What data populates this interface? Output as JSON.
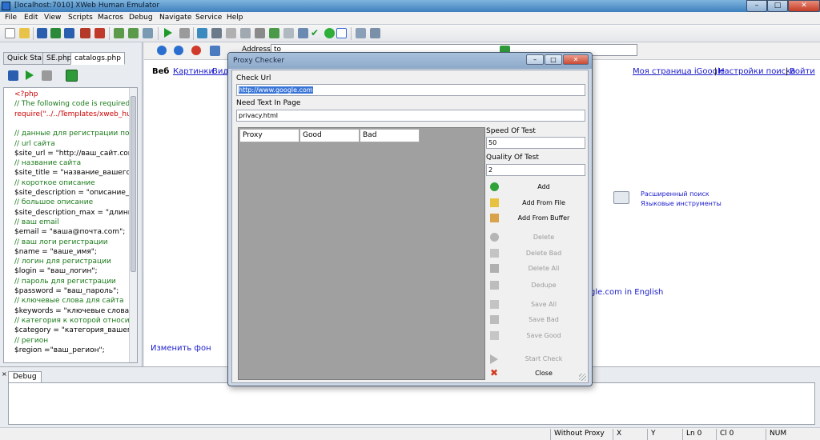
{
  "window": {
    "title": "[localhost:7010] XWeb Human Emulator",
    "minimize": "–",
    "maximize": "□",
    "close": "✕"
  },
  "menu": [
    "File",
    "Edit",
    "View",
    "Scripts",
    "Macros",
    "Debug",
    "Navigate",
    "Service",
    "Help"
  ],
  "left_tabs": [
    "Quick Start",
    "SE.php",
    "catalogs.php"
  ],
  "code_lines": [
    {
      "text": "<?php",
      "cls": "c-kw"
    },
    {
      "text": "// The following code is required",
      "cls": "c-cm"
    },
    {
      "text": "require(\"../../Templates/xweb_hu",
      "cls": "c-kw"
    },
    {
      "text": "",
      "cls": "c-var"
    },
    {
      "text": "// данные для регистрации по к",
      "cls": "c-cm"
    },
    {
      "text": "// url сайта",
      "cls": "c-cm"
    },
    {
      "text": "$site_url = \"http://ваш_сайт.con",
      "cls": "c-var"
    },
    {
      "text": "// название сайта",
      "cls": "c-cm"
    },
    {
      "text": "$site_title = \"название_вашего_",
      "cls": "c-var"
    },
    {
      "text": "// короткое описание",
      "cls": "c-cm"
    },
    {
      "text": "$site_description = \"описание_в",
      "cls": "c-var"
    },
    {
      "text": "// большое описание",
      "cls": "c-cm"
    },
    {
      "text": "$site_description_max = \"длинн",
      "cls": "c-var"
    },
    {
      "text": "// ваш email",
      "cls": "c-cm"
    },
    {
      "text": "$email = \"ваша@почта.com\";",
      "cls": "c-var"
    },
    {
      "text": "// ваш логи регистрации",
      "cls": "c-cm"
    },
    {
      "text": "$name = \"ваше_имя\";",
      "cls": "c-var"
    },
    {
      "text": "// логин для регистрации",
      "cls": "c-cm"
    },
    {
      "text": "$login = \"ваш_логин\";",
      "cls": "c-var"
    },
    {
      "text": "// пароль для регистрации",
      "cls": "c-cm"
    },
    {
      "text": "$password = \"ваш_пароль\";",
      "cls": "c-var"
    },
    {
      "text": "// ключевые слова для сайта",
      "cls": "c-cm"
    },
    {
      "text": "$keywords = \"ключевые слова\"",
      "cls": "c-var"
    },
    {
      "text": "// категория к которой относитс",
      "cls": "c-cm"
    },
    {
      "text": "$category = \"категория_вашего",
      "cls": "c-var"
    },
    {
      "text": "// регион",
      "cls": "c-cm"
    },
    {
      "text": "$region =\"ваш_регион\";",
      "cls": "c-var"
    }
  ],
  "browser": {
    "address_label": "Address",
    "address_value": "to",
    "google_left": [
      "Веб",
      "Картинки",
      "Вид"
    ],
    "google_right": [
      "Моя страница iGoogle",
      "|",
      "Настройки поиска",
      "|",
      "Войти"
    ],
    "advanced_search": "Расширенный поиск",
    "language_tools": "Языковые инструменты",
    "english_link": "gle.com in English",
    "change_bg": "Изменить фон"
  },
  "dialog": {
    "title": "Proxy Checker",
    "check_url_label": "Check Url",
    "check_url_value": "http://www.google.com",
    "need_text_label": "Need Text In Page",
    "need_text_value": "privacy.html",
    "columns": [
      "Proxy",
      "Good",
      "Bad"
    ],
    "speed_label": "Speed Of Test",
    "speed_value": "50",
    "quality_label": "Quality Of Test",
    "quality_value": "2",
    "buttons": {
      "add": "Add",
      "add_from_file": "Add From File",
      "add_from_buffer": "Add From Buffer",
      "delete": "Delete",
      "delete_bad": "Delete Bad",
      "delete_all": "Delete All",
      "dedupe": "Dedupe",
      "save_all": "Save All",
      "save_bad": "Save Bad",
      "save_good": "Save Good",
      "start_check": "Start Check",
      "close": "Close"
    }
  },
  "debug_tab": "Debug",
  "status": {
    "proxy": "Without Proxy",
    "x": "X",
    "y": "Y",
    "ln": "Ln  0",
    "cl": "Cl  0",
    "num": "NUM"
  },
  "colors": {
    "accent": "#3875d7",
    "comment": "#1a7a1a",
    "keyword": "#c00000",
    "link": "#1a1acc"
  }
}
